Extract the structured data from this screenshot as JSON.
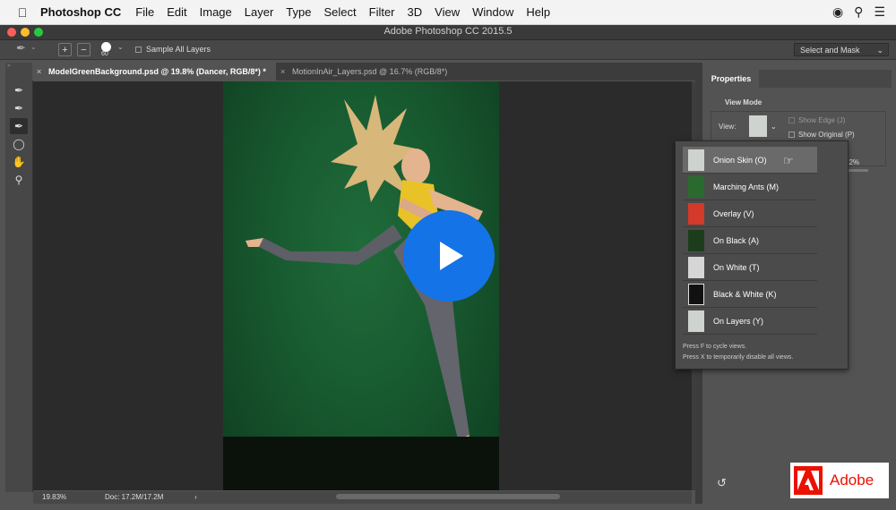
{
  "menubar": {
    "app": "Photoshop CC",
    "items": [
      "File",
      "Edit",
      "Image",
      "Layer",
      "Type",
      "Select",
      "Filter",
      "3D",
      "View",
      "Window",
      "Help"
    ]
  },
  "window": {
    "title": "Adobe Photoshop CC 2015.5"
  },
  "options": {
    "brush_size": "60",
    "sample_all_layers": "Sample All Layers",
    "select_and_mask": "Select and Mask"
  },
  "tabs": [
    {
      "label": "ModelGreenBackground.psd @ 19.8% (Dancer, RGB/8*) *",
      "active": true
    },
    {
      "label": "MotionInAir_Layers.psd @ 16.7% (RGB/8*)",
      "active": false
    }
  ],
  "status": {
    "zoom": "19.83%",
    "doc": "Doc: 17.2M/17.2M",
    "arrow": "›"
  },
  "properties": {
    "tab": "Properties",
    "view_mode_heading": "View Mode",
    "view_label": "View:",
    "show_edge": "Show Edge (J)",
    "show_original": "Show Original (P)",
    "percent_fragment": "12%"
  },
  "view_modes": [
    {
      "label": "Onion Skin (O)",
      "selected": true
    },
    {
      "label": "Marching Ants (M)",
      "selected": false
    },
    {
      "label": "Overlay (V)",
      "selected": false
    },
    {
      "label": "On Black (A)",
      "selected": false
    },
    {
      "label": "On White (T)",
      "selected": false
    },
    {
      "label": "Black & White (K)",
      "selected": false
    },
    {
      "label": "On Layers (Y)",
      "selected": false
    }
  ],
  "hints": {
    "cycle": "Press F to cycle views.",
    "disable": "Press X to temporarily disable all views."
  },
  "badge": {
    "brand": "Adobe"
  },
  "colors": {
    "accent": "#1473e6",
    "adobe_red": "#eb1000",
    "panel": "#535353"
  }
}
